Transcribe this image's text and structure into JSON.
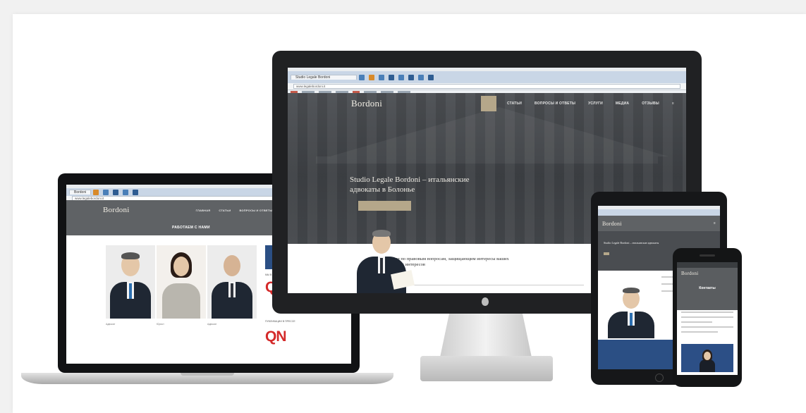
{
  "monitor": {
    "tab_label": "Studio Legale Bordoni",
    "url": "www.legalebordoni.it",
    "logo": "Bordoni",
    "nav": [
      "",
      "СТАТЬИ",
      "ВОПРОСЫ И ОТВЕТЫ",
      "УСЛУГИ",
      "МЕДИА",
      "ОТЗЫВЫ",
      "≡"
    ],
    "hero_title_line1": "Studio Legale Bordoni – итальянские",
    "hero_title_line2": "адвокаты в Болонье",
    "cta": "",
    "intro_text": "Консультации по правовым вопросам, защищающим интересы ваших международных интересов"
  },
  "laptop": {
    "tab_label": "Bordoni",
    "url": "www.legalebordoni.it",
    "logo": "Bordoni",
    "nav": [
      "ГЛАВНАЯ",
      "СТАТЬИ",
      "ВОПРОСЫ И ОТВЕТЫ",
      "УСЛУГИ",
      "",
      "ОТЗЫВЫ",
      "≡"
    ],
    "page_title": "РАБОТАЕМ С НАМИ",
    "captions": [
      "Адвокат",
      "Юрист",
      "Адвокат"
    ],
    "sidebar_label_1": "МЫ В СМИ / ПРЕССА",
    "sidebar_label_2": "ПУБЛИКАЦИИ В ПРЕССЕ",
    "press_logo": "QN"
  },
  "tablet": {
    "logo": "Bordoni",
    "menu": "≡",
    "hero_title": "Studio Legale Bordoni – итальянские адвокаты",
    "cta": ""
  },
  "phone": {
    "logo": "Bordoni",
    "title": "Контакты"
  },
  "colors": {
    "header_gray": "#5f6265",
    "accent_gold": "#b5a78a",
    "press_red": "#d42a2a"
  }
}
